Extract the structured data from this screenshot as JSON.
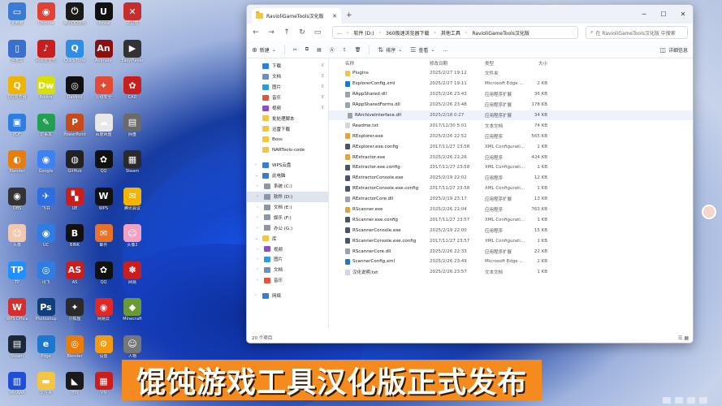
{
  "desktop": {
    "icons": [
      {
        "label": "此电脑",
        "color": "#3a7bd5",
        "glyph": "▭"
      },
      {
        "label": "Chrome",
        "color": "#e34133",
        "glyph": "◉"
      },
      {
        "label": "腾讯QQ游戏",
        "color": "#1a1a1a",
        "glyph": "⏻"
      },
      {
        "label": "Unreal",
        "color": "#111111",
        "glyph": "U"
      },
      {
        "label": "工具箱",
        "color": "#c62d2d",
        "glyph": "✕"
      },
      {
        "label": "回收站",
        "color": "#3a6fd0",
        "glyph": "▯"
      },
      {
        "label": "网易云音乐",
        "color": "#c81e1e",
        "glyph": "♪"
      },
      {
        "label": "QuickTime",
        "color": "#2f8de4",
        "glyph": "Q"
      },
      {
        "label": "Animate",
        "color": "#8a1010",
        "glyph": "An"
      },
      {
        "label": "EasyPlayer",
        "color": "#333333",
        "glyph": "▶"
      },
      {
        "label": "QQ浏览器",
        "color": "#f0b400",
        "glyph": "Q"
      },
      {
        "label": "Adobe",
        "color": "#d8e000",
        "glyph": "Dw"
      },
      {
        "label": "DaVinci",
        "color": "#111111",
        "glyph": "◎"
      },
      {
        "label": "火绒安全",
        "color": "#e24a36",
        "glyph": "✦"
      },
      {
        "label": "CAD",
        "color": "#c81e1e",
        "glyph": "✿"
      },
      {
        "label": "PDF",
        "color": "#2d7de3",
        "glyph": "▣"
      },
      {
        "label": "记事本",
        "color": "#20a050",
        "glyph": "✎"
      },
      {
        "label": "PowerPoint",
        "color": "#c74a1a",
        "glyph": "P"
      },
      {
        "label": "百度网盘",
        "color": "#e8e8e8",
        "glyph": "☁"
      },
      {
        "label": "网盘",
        "color": "#6a6a6a",
        "glyph": "▤"
      },
      {
        "label": "Blender",
        "color": "#e87d0d",
        "glyph": "◐"
      },
      {
        "label": "Google",
        "color": "#3b82f6",
        "glyph": "◉"
      },
      {
        "label": "GitHub",
        "color": "#222222",
        "glyph": "◍"
      },
      {
        "label": "QQ",
        "color": "#111111",
        "glyph": "✿"
      },
      {
        "label": "Steam",
        "color": "#2a2a2a",
        "glyph": "▦"
      },
      {
        "label": "OBS",
        "color": "#333333",
        "glyph": "◉"
      },
      {
        "label": "飞书",
        "color": "#2d6fe0",
        "glyph": "✈"
      },
      {
        "label": "UE",
        "color": "#c81e1e",
        "glyph": "▚"
      },
      {
        "label": "WPS",
        "color": "#111111",
        "glyph": "W"
      },
      {
        "label": "腾讯会议",
        "color": "#f4b400",
        "glyph": "✉"
      },
      {
        "label": "头像",
        "color": "#f2c9b0",
        "glyph": "☺"
      },
      {
        "label": "UC",
        "color": "#2d7de3",
        "glyph": "◉"
      },
      {
        "label": "BINK",
        "color": "#111111",
        "glyph": "B"
      },
      {
        "label": "邮件",
        "color": "#e8722a",
        "glyph": "✉"
      },
      {
        "label": "头像2",
        "color": "#f1a2c2",
        "glyph": "☺"
      },
      {
        "label": "TP",
        "color": "#1e90ff",
        "glyph": "TP"
      },
      {
        "label": "讯飞",
        "color": "#2d7de3",
        "glyph": "◎"
      },
      {
        "label": "AS",
        "color": "#c81e1e",
        "glyph": "AS"
      },
      {
        "label": "QQ",
        "color": "#111111",
        "glyph": "✿"
      },
      {
        "label": "网易",
        "color": "#c81e1e",
        "glyph": "✽"
      },
      {
        "label": "WPS Office",
        "color": "#d22f2f",
        "glyph": "W"
      },
      {
        "label": "Photoshop",
        "color": "#0f3f7a",
        "glyph": "Ps"
      },
      {
        "label": "小狐狸",
        "color": "#2a2a2a",
        "glyph": "✦"
      },
      {
        "label": "网易云",
        "color": "#e02828",
        "glyph": "◉"
      },
      {
        "label": "Minecraft",
        "color": "#6a9a36",
        "glyph": "◆"
      },
      {
        "label": "Steam",
        "color": "#1b2838",
        "glyph": "▤"
      },
      {
        "label": "Edge",
        "color": "#1b78d0",
        "glyph": "e"
      },
      {
        "label": "Blender",
        "color": "#e87d0d",
        "glyph": "◎"
      },
      {
        "label": "设置",
        "color": "#f39c12",
        "glyph": "⚙"
      },
      {
        "label": "人物",
        "color": "#777777",
        "glyph": "☺"
      },
      {
        "label": "WinRAR",
        "color": "#1e4fd6",
        "glyph": "▥"
      },
      {
        "label": "文件夹",
        "color": "#f4c542",
        "glyph": "▬"
      },
      {
        "label": "游戏",
        "color": "#1a1a1a",
        "glyph": "◣"
      },
      {
        "label": "VN",
        "color": "#c81e1e",
        "glyph": "▦"
      }
    ]
  },
  "window": {
    "tab_title": "RavioliGameTools汉化版",
    "tab_close": "✕",
    "new_tab": "+",
    "controls": {
      "minimize": "─",
      "maximize": "☐",
      "close": "✕"
    },
    "nav": {
      "back": "←",
      "forward": "→",
      "up": "↑",
      "refresh": "↻",
      "view": "▭"
    },
    "address": {
      "more": "…",
      "crumbs": [
        "软件 (D:)",
        "360极速浏览器下载",
        "其他工具",
        "RavioliGameTools汉化版"
      ],
      "sep": "›"
    },
    "search_placeholder": "在 RavioliGameTools汉化版 中搜索",
    "cmdbar": {
      "new_label": "新建",
      "sort_label": "排序",
      "view_label": "查看",
      "more": "…",
      "details_label": "详细信息"
    },
    "sidebar": {
      "items": [
        {
          "label": "下载",
          "icon": "download-icon",
          "color": "#2d7de3",
          "pin": true,
          "chev": ""
        },
        {
          "label": "文档",
          "icon": "document-icon",
          "color": "#6d8fbf",
          "pin": true,
          "chev": ""
        },
        {
          "label": "图片",
          "icon": "picture-icon",
          "color": "#2f9ad8",
          "pin": true,
          "chev": ""
        },
        {
          "label": "音乐",
          "icon": "music-icon",
          "color": "#e0563a",
          "pin": true,
          "chev": ""
        },
        {
          "label": "视频",
          "icon": "video-icon",
          "color": "#8a4fd0",
          "pin": true,
          "chev": ""
        },
        {
          "label": "批处理脚本",
          "icon": "folder-icon",
          "color": "#f4c542",
          "pin": false,
          "chev": ""
        },
        {
          "label": "迅雷下载",
          "icon": "folder-icon",
          "color": "#f4c542",
          "pin": false,
          "chev": ""
        },
        {
          "label": "Boss",
          "icon": "folder-icon",
          "color": "#f4c542",
          "pin": false,
          "chev": ""
        },
        {
          "label": "NARTools-code",
          "icon": "folder-icon",
          "color": "#f4c542",
          "pin": false,
          "chev": ""
        },
        {
          "label": "",
          "divider": true
        },
        {
          "label": "WPS云盘",
          "icon": "cloud-icon",
          "color": "#3a7bd5",
          "pin": false,
          "chev": "›"
        },
        {
          "label": "此电脑",
          "icon": "computer-icon",
          "color": "#3a7bd5",
          "pin": false,
          "chev": "⌄"
        },
        {
          "label": "系统 (C:)",
          "icon": "drive-icon",
          "color": "#8c96a6",
          "pin": false,
          "chev": "›",
          "indent": true
        },
        {
          "label": "软件 (D:)",
          "icon": "drive-icon",
          "color": "#8c96a6",
          "pin": false,
          "chev": "›",
          "indent": true,
          "selected": true
        },
        {
          "label": "文档 (E:)",
          "icon": "drive-icon",
          "color": "#8c96a6",
          "pin": false,
          "chev": "›",
          "indent": true
        },
        {
          "label": "娱乐 (F:)",
          "icon": "drive-icon",
          "color": "#8c96a6",
          "pin": false,
          "chev": "›",
          "indent": true
        },
        {
          "label": "办公 (G:)",
          "icon": "drive-icon",
          "color": "#8c96a6",
          "pin": false,
          "chev": "›",
          "indent": true
        },
        {
          "label": "库",
          "icon": "library-icon",
          "color": "#f4c542",
          "pin": false,
          "chev": "⌄"
        },
        {
          "label": "视频",
          "icon": "video-icon",
          "color": "#8a4fd0",
          "pin": false,
          "chev": "›",
          "indent": true
        },
        {
          "label": "图片",
          "icon": "picture-icon",
          "color": "#2f9ad8",
          "pin": false,
          "chev": "›",
          "indent": true
        },
        {
          "label": "文档",
          "icon": "document-icon",
          "color": "#6d8fbf",
          "pin": false,
          "chev": "›",
          "indent": true
        },
        {
          "label": "音乐",
          "icon": "music-icon",
          "color": "#e0563a",
          "pin": false,
          "chev": "›",
          "indent": true
        },
        {
          "label": "",
          "divider": true
        },
        {
          "label": "网络",
          "icon": "network-icon",
          "color": "#3a7bd5",
          "pin": false,
          "chev": "›"
        }
      ]
    },
    "columns": {
      "name": "名称",
      "date": "修改日期",
      "type": "类型",
      "size": "大小"
    },
    "files": [
      {
        "name": "Plugins",
        "date": "2025/2/27 19:12",
        "type": "文件夹",
        "size": "",
        "icon_color": "#f4c542"
      },
      {
        "name": "ExplorerConfig.xml",
        "date": "2025/2/27 19:11",
        "type": "Microsoft Edge ...",
        "size": "2 KB",
        "icon_color": "#1b78d0"
      },
      {
        "name": "RAppShared.dll",
        "date": "2025/2/26 23:43",
        "type": "应用程序扩展",
        "size": "36 KB",
        "icon_color": "#9aa3b0"
      },
      {
        "name": "RAppSharedForms.dll",
        "date": "2025/2/26 23:48",
        "type": "应用程序扩展",
        "size": "178 KB",
        "icon_color": "#9aa3b0"
      },
      {
        "name": "RArchiveInterface.dll",
        "date": "2025/2/18 0:27",
        "type": "应用程序扩展",
        "size": "34 KB",
        "icon_color": "#9aa3b0",
        "hl": true
      },
      {
        "name": "Readme.txt",
        "date": "2017/12/30 5:01",
        "type": "文本文档",
        "size": "74 KB",
        "icon_color": "#cfd6e0"
      },
      {
        "name": "RExplorer.exe",
        "date": "2025/2/26 22:52",
        "type": "应用程序",
        "size": "565 KB",
        "icon_color": "#e8a23a"
      },
      {
        "name": "RExplorer.exe.config",
        "date": "2017/11/27 23:58",
        "type": "XML Configurati...",
        "size": "1 KB",
        "icon_color": "#4a5466"
      },
      {
        "name": "RExtractor.exe",
        "date": "2025/2/26 22:26",
        "type": "应用程序",
        "size": "424 KB",
        "icon_color": "#e8a23a"
      },
      {
        "name": "RExtractor.exe.config",
        "date": "2017/11/27 23:58",
        "type": "XML Configurati...",
        "size": "1 KB",
        "icon_color": "#4a5466"
      },
      {
        "name": "RExtractorConsole.exe",
        "date": "2025/2/19 22:02",
        "type": "应用程序",
        "size": "12 KB",
        "icon_color": "#4a5466"
      },
      {
        "name": "RExtractorConsole.exe.config",
        "date": "2017/11/27 23:58",
        "type": "XML Configurati...",
        "size": "1 KB",
        "icon_color": "#4a5466"
      },
      {
        "name": "RExtractorCore.dll",
        "date": "2025/2/19 23:17",
        "type": "应用程序扩展",
        "size": "13 KB",
        "icon_color": "#9aa3b0"
      },
      {
        "name": "RScanner.exe",
        "date": "2025/2/26 22:04",
        "type": "应用程序",
        "size": "763 KB",
        "icon_color": "#e8a23a"
      },
      {
        "name": "RScanner.exe.config",
        "date": "2017/11/27 23:57",
        "type": "XML Configurati...",
        "size": "1 KB",
        "icon_color": "#4a5466"
      },
      {
        "name": "RScannerConsole.exe",
        "date": "2025/2/19 22:00",
        "type": "应用程序",
        "size": "15 KB",
        "icon_color": "#4a5466"
      },
      {
        "name": "RScannerConsole.exe.config",
        "date": "2017/11/27 23:57",
        "type": "XML Configurati...",
        "size": "1 KB",
        "icon_color": "#4a5466"
      },
      {
        "name": "RScannerCore.dll",
        "date": "2025/2/26 22:33",
        "type": "应用程序扩展",
        "size": "22 KB",
        "icon_color": "#9aa3b0"
      },
      {
        "name": "ScannerConfig.xml",
        "date": "2025/2/26 23:49",
        "type": "Microsoft Edge ...",
        "size": "2 KB",
        "icon_color": "#1b78d0"
      },
      {
        "name": "汉化说明.txt",
        "date": "2025/2/26 23:57",
        "type": "文本文档",
        "size": "1 KB",
        "icon_color": "#cfd6e0"
      }
    ],
    "status": "20 个项目"
  },
  "banner": {
    "text": "馄饨游戏工具汉化版正式发布",
    "bg": "#f58b1f"
  }
}
